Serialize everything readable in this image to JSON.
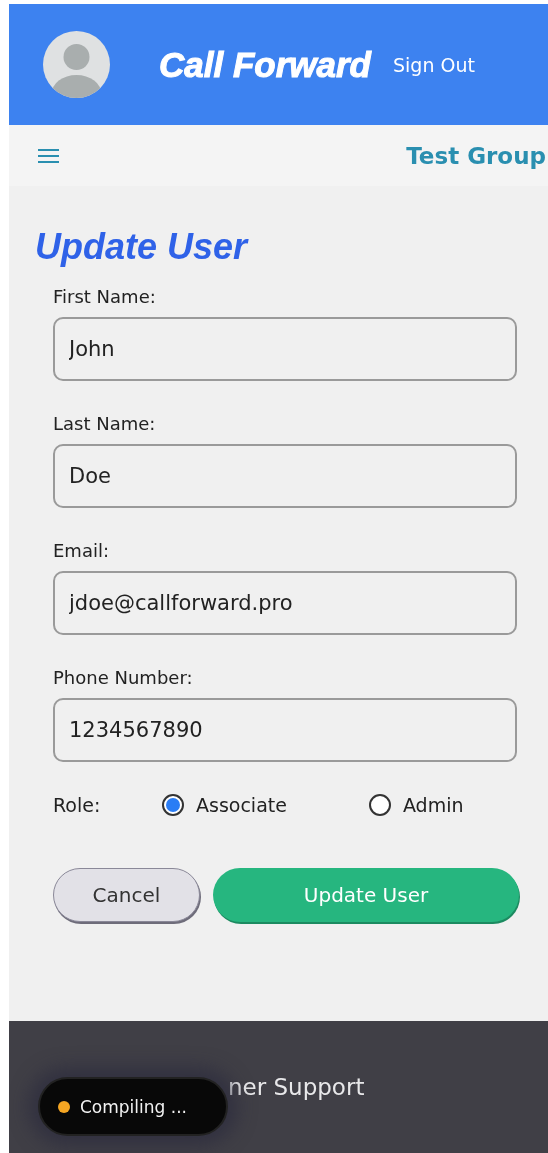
{
  "header": {
    "title": "Call Forward",
    "sign_out": "Sign Out"
  },
  "nav": {
    "group": "Test Group"
  },
  "form": {
    "heading": "Update User",
    "fields": [
      {
        "label": "First Name:",
        "value": "John"
      },
      {
        "label": "Last Name:",
        "value": "Doe"
      },
      {
        "label": "Email:",
        "value": "jdoe@callforward.pro"
      },
      {
        "label": "Phone Number:",
        "value": "1234567890"
      }
    ],
    "role_label": "Role:",
    "roles": [
      {
        "label": "Associate",
        "selected": true
      },
      {
        "label": "Admin",
        "selected": false
      }
    ],
    "buttons": [
      {
        "label": "Cancel",
        "kind": "secondary"
      },
      {
        "label": "Update User",
        "kind": "primary"
      }
    ]
  },
  "footer": {
    "link": "ner Support"
  },
  "toast": {
    "text": "Compiling ..."
  }
}
